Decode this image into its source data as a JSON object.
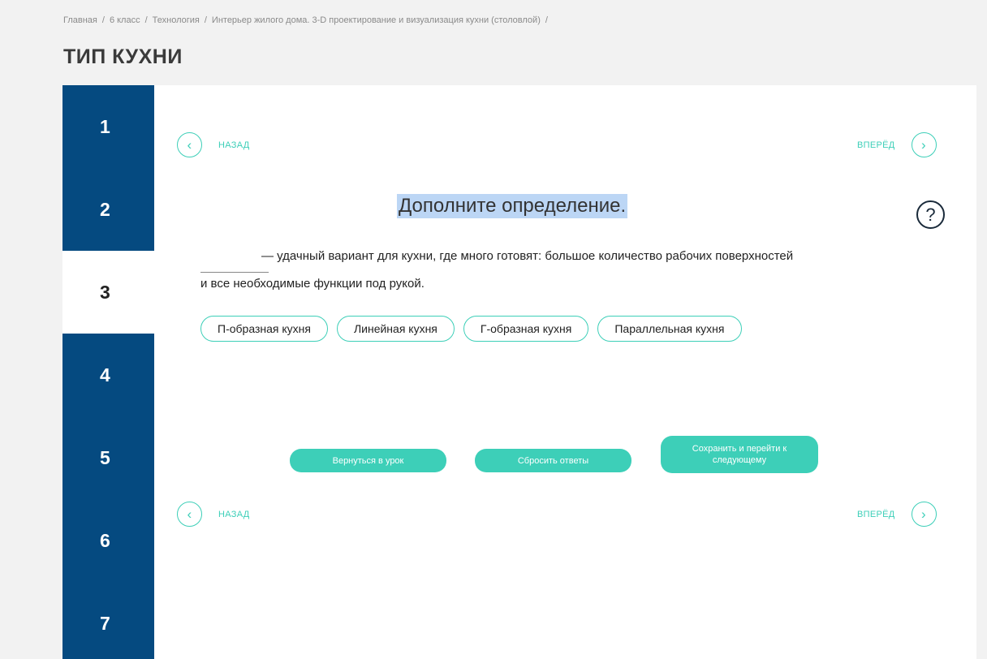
{
  "breadcrumb": [
    {
      "label": "Главная"
    },
    {
      "label": "6 класс"
    },
    {
      "label": "Технология"
    },
    {
      "label": "Интерьер жилого дома. 3-D проектирование и визуализация кухни (столовлой)"
    }
  ],
  "page_title": "ТИП КУХНИ",
  "steps": [
    {
      "label": "1",
      "active": false
    },
    {
      "label": "2",
      "active": false
    },
    {
      "label": "3",
      "active": true
    },
    {
      "label": "4",
      "active": false
    },
    {
      "label": "5",
      "active": false
    },
    {
      "label": "6",
      "active": false
    },
    {
      "label": "7",
      "active": false
    }
  ],
  "nav": {
    "back_label": "НАЗАД",
    "forward_label": "ВПЕРЁД",
    "back_icon": "chevron-left-icon",
    "forward_icon": "chevron-right-icon"
  },
  "question": {
    "heading": "Дополните определение.",
    "definition_part1": "— удачный вариант для кухни, где много готовят: большое количество рабочих поверхностей",
    "definition_part2": "и все необходимые функции под рукой.",
    "help_icon": "?"
  },
  "options": [
    {
      "label": "П-образная кухня"
    },
    {
      "label": "Линейная кухня"
    },
    {
      "label": "Г-образная кухня"
    },
    {
      "label": "Параллельная кухня"
    }
  ],
  "actions": {
    "return_label": "Вернуться в урок",
    "reset_label": "Сбросить ответы",
    "save_label": "Сохранить и перейти к следующему"
  },
  "colors": {
    "accent": "#3dcfb8",
    "sidebar": "#054a80",
    "highlight": "#bcd6f5"
  }
}
